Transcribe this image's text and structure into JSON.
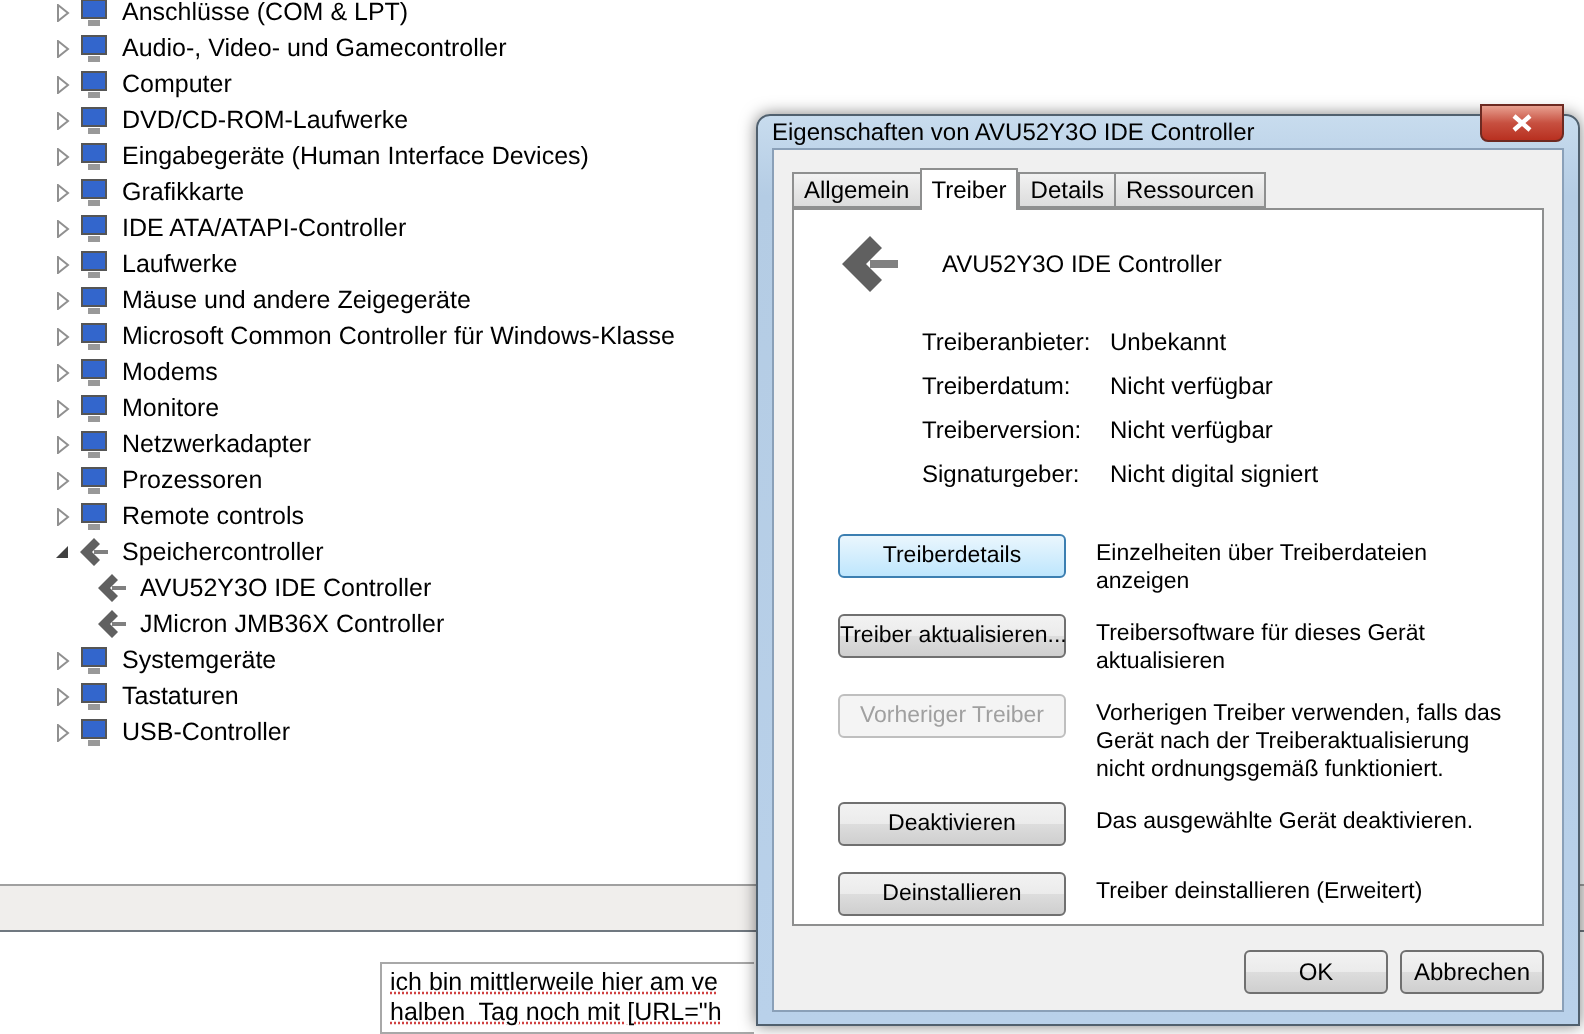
{
  "device_tree": [
    {
      "label": "Anschlüsse (COM & LPT)",
      "expanded": false
    },
    {
      "label": "Audio-, Video- und Gamecontroller",
      "expanded": false
    },
    {
      "label": "Computer",
      "expanded": false
    },
    {
      "label": "DVD/CD-ROM-Laufwerke",
      "expanded": false
    },
    {
      "label": "Eingabegeräte (Human Interface Devices)",
      "expanded": false
    },
    {
      "label": "Grafikkarte",
      "expanded": false
    },
    {
      "label": "IDE ATA/ATAPI-Controller",
      "expanded": false
    },
    {
      "label": "Laufwerke",
      "expanded": false
    },
    {
      "label": "Mäuse und andere Zeigegeräte",
      "expanded": false
    },
    {
      "label": "Microsoft Common Controller für Windows-Klasse",
      "expanded": false
    },
    {
      "label": "Modems",
      "expanded": false
    },
    {
      "label": "Monitore",
      "expanded": false
    },
    {
      "label": "Netzwerkadapter",
      "expanded": false
    },
    {
      "label": "Prozessoren",
      "expanded": false
    },
    {
      "label": "Remote controls",
      "expanded": false
    },
    {
      "label": "Speichercontroller",
      "expanded": true,
      "children": [
        {
          "label": "AVU52Y3O IDE Controller"
        },
        {
          "label": "JMicron JMB36X Controller"
        }
      ]
    },
    {
      "label": "Systemgeräte",
      "expanded": false
    },
    {
      "label": "Tastaturen",
      "expanded": false
    },
    {
      "label": "USB-Controller",
      "expanded": false
    }
  ],
  "editor_text": [
    "ich bin mittlerweile hier am ve",
    "halben  Tag noch mit [URL=\"h"
  ],
  "dialog": {
    "title": "Eigenschaften von AVU52Y3O IDE Controller",
    "tabs": [
      {
        "label": "Allgemein",
        "selected": false
      },
      {
        "label": "Treiber",
        "selected": true
      },
      {
        "label": "Details",
        "selected": false
      },
      {
        "label": "Ressourcen",
        "selected": false
      }
    ],
    "device_name": "AVU52Y3O IDE Controller",
    "info": [
      {
        "label": "Treiberanbieter:",
        "value": "Unbekannt"
      },
      {
        "label": "Treiberdatum:",
        "value": "Nicht verfügbar"
      },
      {
        "label": "Treiberversion:",
        "value": "Nicht verfügbar"
      },
      {
        "label": "Signaturgeber:",
        "value": "Nicht digital signiert"
      }
    ],
    "actions": [
      {
        "button": "Treiberdetails",
        "description": "Einzelheiten über Treiberdateien anzeigen",
        "disabled": false,
        "focused": true
      },
      {
        "button": "Treiber aktualisieren...",
        "description": "Treibersoftware für dieses Gerät aktualisieren",
        "disabled": false,
        "focused": false
      },
      {
        "button": "Vorheriger Treiber",
        "description": "Vorherigen Treiber verwenden, falls das Gerät nach der Treiberaktualisierung nicht ordnungsgemäß funktioniert.",
        "disabled": true,
        "focused": false
      },
      {
        "button": "Deaktivieren",
        "description": "Das ausgewählte Gerät deaktivieren.",
        "disabled": false,
        "focused": false
      },
      {
        "button": "Deinstallieren",
        "description": "Treiber deinstallieren (Erweitert)",
        "disabled": false,
        "focused": false
      }
    ],
    "footer_buttons": [
      "OK",
      "Abbrechen"
    ]
  }
}
